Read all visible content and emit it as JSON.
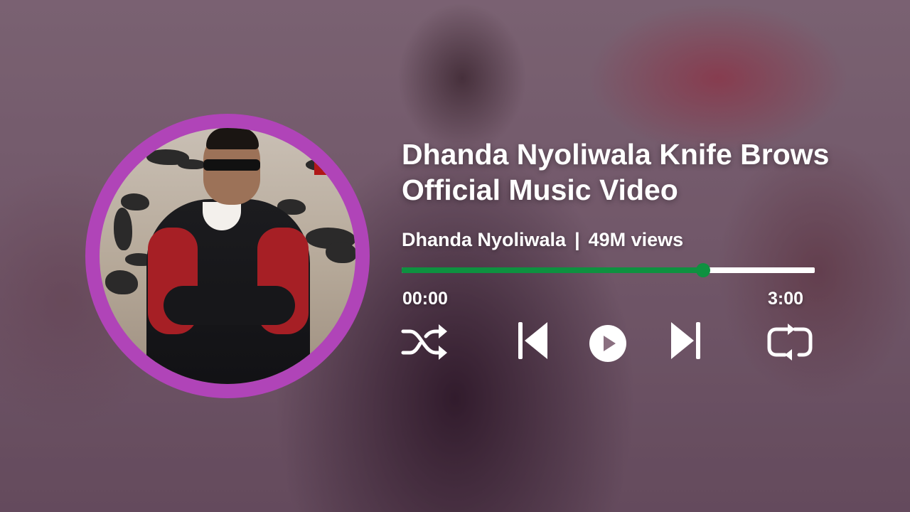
{
  "track": {
    "title_line1": "Dhanda Nyoliwala Knife Brows",
    "title_line2": "Official Music Video",
    "artist": "Dhanda Nyoliwala",
    "separator": "|",
    "views": "49M views"
  },
  "player": {
    "current_time": "00:00",
    "duration": "3:00",
    "progress_fraction": 0.73,
    "progress_color": "#0e9140",
    "track_color": "#ffffff"
  },
  "controls": {
    "shuffle_icon": "shuffle-icon",
    "previous_icon": "skip-previous-icon",
    "play_icon": "play-icon",
    "next_icon": "skip-next-icon",
    "repeat_icon": "repeat-icon"
  },
  "colors": {
    "ring": "#b044b8",
    "text": "#ffffff"
  }
}
